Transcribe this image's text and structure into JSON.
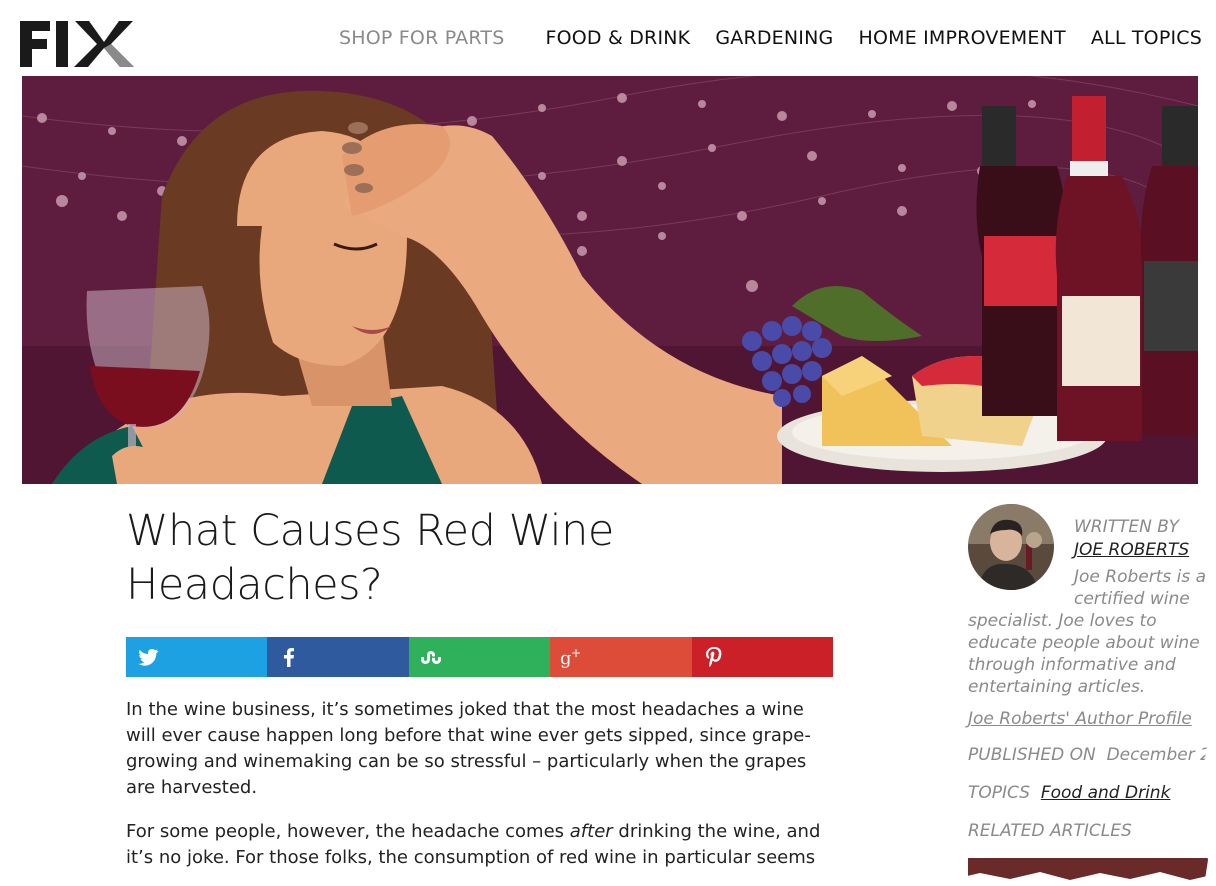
{
  "header": {
    "logo_text": "FIX",
    "nav": {
      "shop": "SHOP FOR PARTS",
      "items": [
        "FOOD & DRINK",
        "GARDENING",
        "HOME IMPROVEMENT",
        "ALL TOPICS"
      ]
    }
  },
  "hero": {
    "image_colors": {
      "background": "#5a1a3a",
      "wine": "#7a0d1e",
      "skin": "#e8a87c",
      "hair": "#6b3a22"
    }
  },
  "article": {
    "title": "What Causes Red Wine Headaches?",
    "share": [
      {
        "network": "twitter",
        "icon": "twitter-icon",
        "color": "#1da1e2"
      },
      {
        "network": "facebook",
        "icon": "facebook-icon",
        "color": "#2f5a9e"
      },
      {
        "network": "stumbleupon",
        "icon": "stumbleupon-icon",
        "color": "#2eb15a"
      },
      {
        "network": "google-plus",
        "icon": "google-plus-icon",
        "color": "#dd4b39"
      },
      {
        "network": "pinterest",
        "icon": "pinterest-icon",
        "color": "#cb2027"
      }
    ],
    "paragraph1": "In the wine business, it’s sometimes joked that the most headaches a wine will ever cause happen long before that wine ever gets sipped, since grape-growing and winemaking can be so stressful – particularly when the grapes are harvested.",
    "paragraph2_pre": "For some people, however, the headache comes ",
    "paragraph2_em": "after",
    "paragraph2_post": " drinking the wine, and it’s no joke. For those folks, the consumption of red wine in particular seems to"
  },
  "sidebar": {
    "written_by": "WRITTEN BY",
    "author": "JOE ROBERTS",
    "bio": "Joe Roberts is a certified wine specialist. Joe loves to educate people about wine through informative and entertaining articles.",
    "bio_line1": "Joe Roberts is a",
    "bio_line2": "certified wine",
    "bio_rest": "specialist. Joe loves to educate people about wine through informative and entertaining articles.",
    "profile_link": "Joe Roberts' Author Profile",
    "published_label": "PUBLISHED ON",
    "published_date": "December 2",
    "topics_label": "TOPICS",
    "topic": "Food and Drink",
    "related_label": "RELATED ARTICLES"
  }
}
